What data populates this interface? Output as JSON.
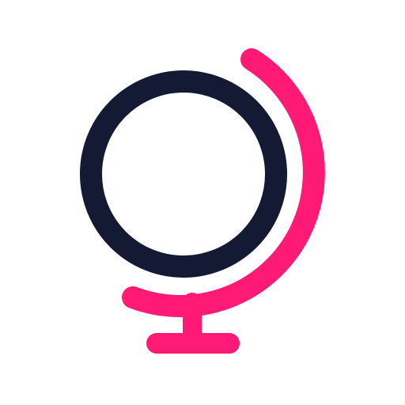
{
  "icon": {
    "name": "globe-icon",
    "colors": {
      "background": "#ffffff",
      "globe": "#141a33",
      "stand": "#ff1a75"
    }
  }
}
